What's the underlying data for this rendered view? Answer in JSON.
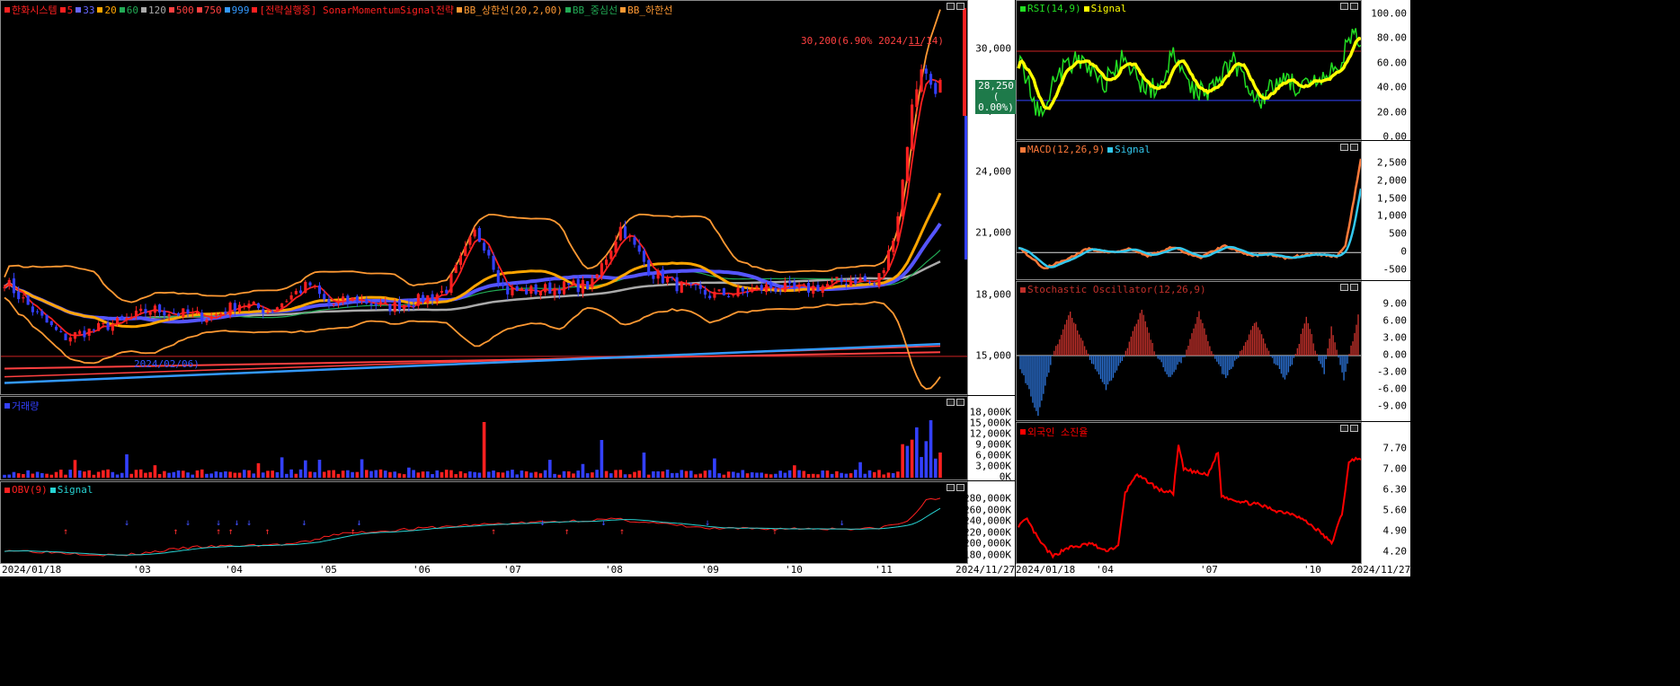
{
  "colors": {
    "up": "#ff2020",
    "down": "#3340ff",
    "obv_signal": "#27d3d3",
    "rsi": "#22dd22",
    "rsi_signal": "#ffff00",
    "macd": "#ff7a3a",
    "macd_signal": "#33c8ee",
    "stoch_up": "#c0302a",
    "stoch_dn": "#2a6fd0",
    "foreign": "#ff0000"
  },
  "main": {
    "legend": [
      {
        "label": "한화시스템",
        "color": "#ff2020"
      },
      {
        "label": "5",
        "color": "#ff2020"
      },
      {
        "label": "33",
        "color": "#6666ff"
      },
      {
        "label": "20",
        "color": "#ffa500"
      },
      {
        "label": "60",
        "color": "#22aa55"
      },
      {
        "label": "120",
        "color": "#aaaaaa"
      },
      {
        "label": "500",
        "color": "#ff4040"
      },
      {
        "label": "750",
        "color": "#ff4040"
      },
      {
        "label": "999",
        "color": "#3399ff"
      },
      {
        "label": "[전략실행중] SonarMomentumSignal전략",
        "color": "#ff2020"
      },
      {
        "label": "BB_상한선(20,2,00)",
        "color": "#ff9933"
      },
      {
        "label": "BB_중심선",
        "color": "#22aa55"
      },
      {
        "label": "BB_하한선",
        "color": "#ff9933"
      }
    ],
    "yticks": [
      "30,000",
      "27,000",
      "24,000",
      "21,000",
      "18,000",
      "15,000"
    ],
    "ytick_values": [
      30000,
      27000,
      24000,
      21000,
      18000,
      15000
    ],
    "price_tag": {
      "line1": "28,250",
      "line2": "( 0.00%)"
    },
    "high_annot": "30,200(6.90% 2024/11/14)",
    "low_annot": "2024/02/06)"
  },
  "volume": {
    "legend": [
      {
        "label": "거래량",
        "color": "#3340ff"
      }
    ],
    "yticks": [
      "18,000K",
      "15,000K",
      "12,000K",
      "9,000K",
      "6,000K",
      "3,000K",
      "0K"
    ],
    "ytick_values": [
      18000,
      15000,
      12000,
      9000,
      6000,
      3000,
      0
    ]
  },
  "obv": {
    "legend": [
      {
        "label": "OBV(9)",
        "color": "#ff2020"
      },
      {
        "label": "Signal",
        "color": "#27d3d3"
      }
    ],
    "yticks": [
      "280,000K",
      "260,000K",
      "240,000K",
      "220,000K",
      "200,000K",
      "180,000K"
    ],
    "ytick_values": [
      280000,
      260000,
      240000,
      220000,
      200000,
      180000
    ]
  },
  "rsi": {
    "legend": [
      {
        "label": "RSI(14,9)",
        "color": "#22dd22"
      },
      {
        "label": "Signal",
        "color": "#ffff00"
      }
    ],
    "yticks": [
      "100.00",
      "80.00",
      "60.00",
      "40.00",
      "20.00",
      "0.00"
    ],
    "ytick_values": [
      100,
      80,
      60,
      40,
      20,
      0
    ]
  },
  "macd": {
    "legend": [
      {
        "label": "MACD(12,26,9)",
        "color": "#ff7a3a"
      },
      {
        "label": "Signal",
        "color": "#33c8ee"
      }
    ],
    "yticks": [
      "2,500",
      "2,000",
      "1,500",
      "1,000",
      "500",
      "0",
      "-500"
    ],
    "ytick_values": [
      2500,
      2000,
      1500,
      1000,
      500,
      0,
      -500
    ]
  },
  "stoch": {
    "legend": [
      {
        "label": "Stochastic Oscillator(12,26,9)",
        "color": "#c0302a"
      }
    ],
    "yticks": [
      "9.00",
      "6.00",
      "3.00",
      "0.00",
      "-3.00",
      "-6.00",
      "-9.00"
    ],
    "ytick_values": [
      9,
      6,
      3,
      0,
      -3,
      -6,
      -9
    ]
  },
  "foreign": {
    "legend": [
      {
        "label": "외국인 소진율",
        "color": "#ff0000"
      }
    ],
    "yticks": [
      "7.70",
      "7.00",
      "6.30",
      "5.60",
      "4.90",
      "4.20"
    ],
    "ytick_values": [
      7.7,
      7.0,
      6.3,
      5.6,
      4.9,
      4.2
    ]
  },
  "xaxis_left": {
    "labels": [
      "2024/01/18",
      "'03",
      "'04",
      "'05",
      "'06",
      "'07",
      "'08",
      "'09",
      "'10",
      "'11"
    ],
    "end": "2024/11/27"
  },
  "xaxis_right": {
    "labels": [
      "2024/01/18",
      "'04",
      "'07",
      "'10"
    ],
    "end": "2024/11/27"
  },
  "chart_data": [
    {
      "type": "candlestick",
      "name": "한화시스템",
      "x_start": "2024/01/18",
      "x_end": "2024/11/27",
      "close_path": [
        [
          0,
          18700
        ],
        [
          5,
          17200
        ],
        [
          10,
          15900
        ],
        [
          15,
          16300
        ],
        [
          20,
          16700
        ],
        [
          25,
          17300
        ],
        [
          30,
          17100
        ],
        [
          35,
          16900
        ],
        [
          40,
          17600
        ],
        [
          45,
          17200
        ],
        [
          50,
          18200
        ],
        [
          52,
          18500
        ],
        [
          55,
          17500
        ],
        [
          60,
          17800
        ],
        [
          65,
          17400
        ],
        [
          70,
          17700
        ],
        [
          75,
          18200
        ],
        [
          80,
          21000
        ],
        [
          82,
          20400
        ],
        [
          85,
          18200
        ],
        [
          90,
          18200
        ],
        [
          95,
          18400
        ],
        [
          100,
          18500
        ],
        [
          105,
          21400
        ],
        [
          107,
          20400
        ],
        [
          110,
          19100
        ],
        [
          115,
          18400
        ],
        [
          120,
          18000
        ],
        [
          125,
          18100
        ],
        [
          130,
          18400
        ],
        [
          135,
          18200
        ],
        [
          140,
          18500
        ],
        [
          145,
          18800
        ],
        [
          148,
          18500
        ],
        [
          150,
          19500
        ],
        [
          152,
          22000
        ],
        [
          153,
          24000
        ],
        [
          154,
          26500
        ],
        [
          155,
          28000
        ],
        [
          156,
          29300
        ],
        [
          157,
          28500
        ],
        [
          158,
          28250
        ]
      ],
      "high": 30200,
      "high_date": "2024/11/14",
      "last": 28250,
      "last_change": "0.00%",
      "ylim": [
        13500,
        31500
      ]
    },
    {
      "type": "bar",
      "name": "거래량",
      "unit": "K",
      "peak": 16500,
      "ylim": [
        0,
        19000
      ]
    },
    {
      "type": "line",
      "name": "OBV(9)",
      "unit": "K",
      "start": 190000,
      "end": 285000,
      "ylim": [
        170000,
        295000
      ]
    },
    {
      "type": "line",
      "name": "RSI(14,9)",
      "ylim": [
        0,
        105
      ],
      "levels": [
        70,
        30
      ]
    },
    {
      "type": "line",
      "name": "MACD(12,26,9)",
      "ylim": [
        -700,
        2800
      ],
      "end_macd": 2600,
      "end_signal": 1950
    },
    {
      "type": "bar",
      "name": "Stochastic Oscillator(12,26,9)",
      "ylim": [
        -11,
        11
      ]
    },
    {
      "type": "line",
      "name": "외국인 소진율",
      "ylim": [
        3.9,
        8.2
      ],
      "end": 7.3
    }
  ]
}
